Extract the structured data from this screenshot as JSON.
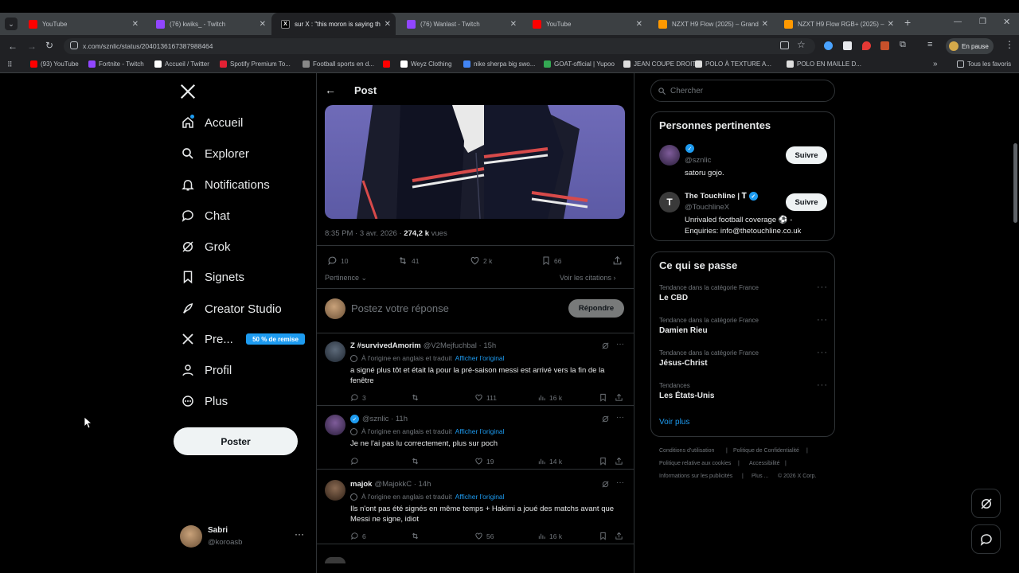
{
  "browser": {
    "tabs": [
      {
        "title": "YouTube",
        "color": "#ff0000"
      },
      {
        "title": "(76) kwiks_ - Twitch",
        "color": "#9146ff"
      },
      {
        "title": "sur X : \"this moron is saying th",
        "color": "#000000"
      },
      {
        "title": "(76) Wanlast - Twitch",
        "color": "#9146ff"
      },
      {
        "title": "YouTube",
        "color": "#ff0000"
      },
      {
        "title": "NZXT H9 Flow (2025) – Grand",
        "color": "#ff9900"
      },
      {
        "title": "NZXT H9 Flow RGB+ (2025) – (",
        "color": "#ff9900"
      }
    ],
    "url": "x.com/sznlic/status/2040136167387988464",
    "profile_status": "En pause",
    "bookmarks": [
      {
        "label": "(93) YouTube",
        "color": "#ff0000"
      },
      {
        "label": "Fortnite - Twitch",
        "color": "#9146ff"
      },
      {
        "label": "Accueil / Twitter",
        "color": "#ffffff"
      },
      {
        "label": "Spotify Premium To...",
        "color": "#e22134"
      },
      {
        "label": "Football sports en d...",
        "color": "#888888"
      },
      {
        "label": "",
        "color": "#ff0000"
      },
      {
        "label": "Weyz Clothing",
        "color": "#ffffff"
      },
      {
        "label": "nike sherpa big swo...",
        "color": "#4285f4"
      },
      {
        "label": "GOAT-official | Yupoo",
        "color": "#34a853"
      },
      {
        "label": "JEAN COUPE DROIT...",
        "color": "#dddddd"
      },
      {
        "label": "POLO À TEXTURE A...",
        "color": "#dddddd"
      },
      {
        "label": "POLO EN MAILLE D...",
        "color": "#dddddd"
      }
    ],
    "all_bookmarks": "Tous les favoris"
  },
  "nav": {
    "items": [
      {
        "label": "Accueil",
        "icon": "home-icon"
      },
      {
        "label": "Explorer",
        "icon": "search-icon"
      },
      {
        "label": "Notifications",
        "icon": "bell-icon"
      },
      {
        "label": "Chat",
        "icon": "chat-icon"
      },
      {
        "label": "Grok",
        "icon": "grok-icon"
      },
      {
        "label": "Signets",
        "icon": "bookmark-icon"
      },
      {
        "label": "Creator Studio",
        "icon": "rocket-icon"
      },
      {
        "label": "Pre...",
        "icon": "x-logo-icon"
      },
      {
        "label": "Profil",
        "icon": "person-icon"
      },
      {
        "label": "Plus",
        "icon": "more-circle-icon"
      }
    ],
    "premium_badge": "50 % de remise",
    "post_button": "Poster",
    "user": {
      "name": "Sabri",
      "handle": "@koroasb"
    }
  },
  "post": {
    "header": "Post",
    "timestamp": "8:35 PM · 3 avr. 2026 · ",
    "views_count": "274,2 k",
    "views_label": " vues",
    "replies": "10",
    "reposts": "41",
    "likes": "2 k",
    "bookmarks": "66",
    "sort": "Pertinence",
    "view_quotes": "Voir les citations",
    "reply_placeholder": "Postez votre réponse",
    "reply_button": "Répondre"
  },
  "replies": [
    {
      "name": "Z #survivedAmorim",
      "handle": "@V2Mejfuchbal · 15h",
      "translated": "À l'origine en anglais et traduit",
      "show_original": "Afficher l'original",
      "text": "a signé plus tôt et était là pour la pré-saison messi est arrivé vers la fin de la fenêtre",
      "replies": "3",
      "reposts": "",
      "likes": "111",
      "views": "16 k"
    },
    {
      "name": "",
      "handle": "@sznlic · 11h",
      "translated": "À l'origine en anglais et traduit",
      "show_original": "Afficher l'original",
      "text": "Je ne l'ai pas lu correctement, plus sur poch",
      "replies": "",
      "reposts": "",
      "likes": "19",
      "views": "14 k"
    },
    {
      "name": "majok",
      "handle": "@MajokkC · 14h",
      "translated": "À l'origine en anglais et traduit",
      "show_original": "Afficher l'original",
      "text": "Ils n'ont pas été signés en même temps + Hakimi a joué des matchs avant que Messi ne signe, idiot",
      "replies": "6",
      "reposts": "",
      "likes": "56",
      "views": "16 k"
    }
  ],
  "search": {
    "placeholder": "Chercher"
  },
  "relevant": {
    "title": "Personnes pertinentes",
    "people": [
      {
        "name": "",
        "handle": "@sznlic",
        "bio": "satoru gojo.",
        "follow": "Suivre"
      },
      {
        "name": "The Touchline | 𝐓",
        "handle": "@TouchlineX",
        "bio": "Unrivaled football coverage ⚽️ - Enquiries: info@thetouchline.co.uk",
        "follow": "Suivre"
      }
    ]
  },
  "trends": {
    "title": "Ce qui se passe",
    "items": [
      {
        "category": "Tendance dans la catégorie France",
        "name": "Le CBD"
      },
      {
        "category": "Tendance dans la catégorie France",
        "name": "Damien Rieu"
      },
      {
        "category": "Tendance dans la catégorie France",
        "name": "Jésus-Christ"
      },
      {
        "category": "Tendances",
        "name": "Les États-Unis"
      }
    ],
    "show_more": "Voir plus"
  },
  "footer": {
    "links": [
      "Conditions d'utilisation",
      "|",
      "Politique de Confidentialité",
      "|",
      "Politique relative aux cookies",
      "|",
      "Accessibilité",
      "|",
      "Informations sur les publicités",
      "|",
      "Plus ...",
      "© 2026 X Corp."
    ]
  },
  "colors": {
    "accent": "#1d9bf0",
    "background": "#000000",
    "border": "#2f3336"
  }
}
